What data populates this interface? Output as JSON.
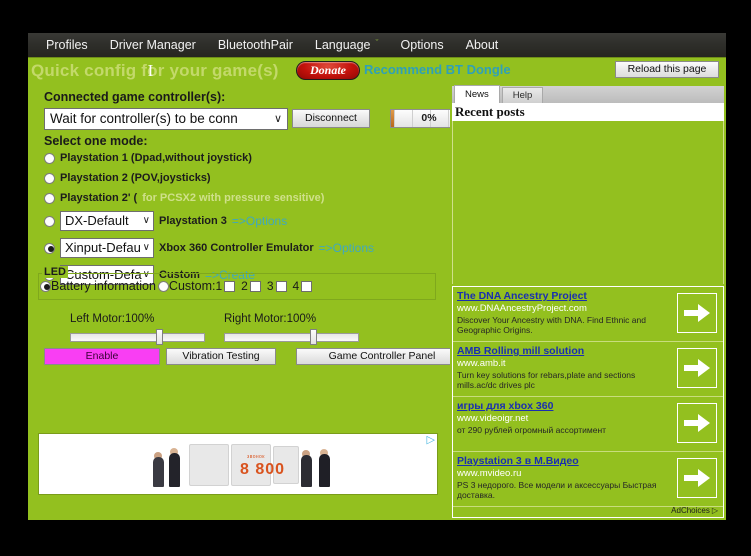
{
  "menubar": {
    "items": [
      {
        "label": "Profiles",
        "caret": ""
      },
      {
        "label": "Driver Manager",
        "caret": ""
      },
      {
        "label": "BluetoothPair",
        "caret": ""
      },
      {
        "label": "Language",
        "caret": "ˇ"
      },
      {
        "label": "Options",
        "caret": ""
      },
      {
        "label": "About",
        "caret": ""
      }
    ]
  },
  "titlebar": {
    "title": "Quick config for your game(s)",
    "caret_glyph": "I",
    "donate_label": "Donate",
    "recommend_label": "Recommend BT Dongle",
    "reload_label": "Reload this page"
  },
  "config": {
    "connected_label": "Connected game controller(s):",
    "controller_select_value": "Wait for controller(s) to be conn",
    "controller_select_caret": "∨",
    "disconnect_label": "Disconnect",
    "battery_percent": "0%",
    "mode_label": "Select one mode:",
    "modes": [
      {
        "radio_selected": false,
        "text": "Playstation 1 (Dpad,without joystick)",
        "dim": "",
        "link": "",
        "select": null
      },
      {
        "radio_selected": false,
        "text": "Playstation 2 (POV,joysticks)",
        "dim": "",
        "link": "",
        "select": null
      },
      {
        "radio_selected": false,
        "text": "Playstation 2' (",
        "dim": "for PCSX2 with pressure sensitive)",
        "link": "",
        "select": null
      },
      {
        "radio_selected": false,
        "text": "Playstation 3",
        "dim": "",
        "link": "=>Options",
        "select": "DX-Default"
      },
      {
        "radio_selected": true,
        "text": "Xbox 360 Controller Emulator",
        "dim": "",
        "link": "=>Options",
        "select": "Xinput-Defau"
      },
      {
        "radio_selected": false,
        "text": "Custom",
        "dim": "",
        "link": "=>Create",
        "select": "Custom-Defa"
      }
    ],
    "led": {
      "legend": "LED",
      "battery_info_label": "Battery information",
      "battery_info_selected": true,
      "custom_label": "Custom:",
      "custom_selected": false,
      "numbers": [
        "1",
        "2",
        "3",
        "4"
      ]
    },
    "motors": {
      "left_label": "Left Motor:100%",
      "right_label": "Right Motor:100%",
      "left_value": 100,
      "right_value": 100
    },
    "buttons": {
      "enable": "Enable",
      "vibration_testing": "Vibration Testing",
      "game_controller_panel": "Game Controller Panel"
    },
    "banner_ad": {
      "number": "8 800",
      "small_text": "звонок",
      "ad_badge": "▷"
    }
  },
  "sidebar": {
    "tabs": [
      {
        "label": "News",
        "active": true
      },
      {
        "label": "Help",
        "active": false
      }
    ],
    "recent_posts_heading": "Recent posts",
    "ads": [
      {
        "title": "The DNA Ancestry Project",
        "url": "www.DNAAncestryProject.com",
        "desc": "Discover Your Ancestry with DNA. Find Ethnic and Geographic Origins."
      },
      {
        "title": "AMB Rolling mill solution",
        "url": "www.amb.it",
        "desc": "Turn key solutions for rebars,plate and sections mills.ac/dc drives plc"
      },
      {
        "title": "игры для xbox 360",
        "url": "www.videoigr.net",
        "desc": "от 290 рублей огромный ассортимент"
      },
      {
        "title": "Playstation 3 в М.Видео",
        "url": "www.mvideo.ru",
        "desc": "PS 3 недорого. Все модели и аксессуары Быстрая доставка."
      }
    ],
    "adchoices_label": "AdChoices",
    "adchoices_glyph": "▷"
  },
  "colors": {
    "app_green": "#93c01f",
    "menubar_dark": "#2e2e2a",
    "title_text": "#c3d96a",
    "link_teal": "#2fa0b8",
    "enable_magenta": "#f93ef3",
    "ad_title_blue": "#1a2fb0",
    "donate_red": "#c2110b"
  }
}
